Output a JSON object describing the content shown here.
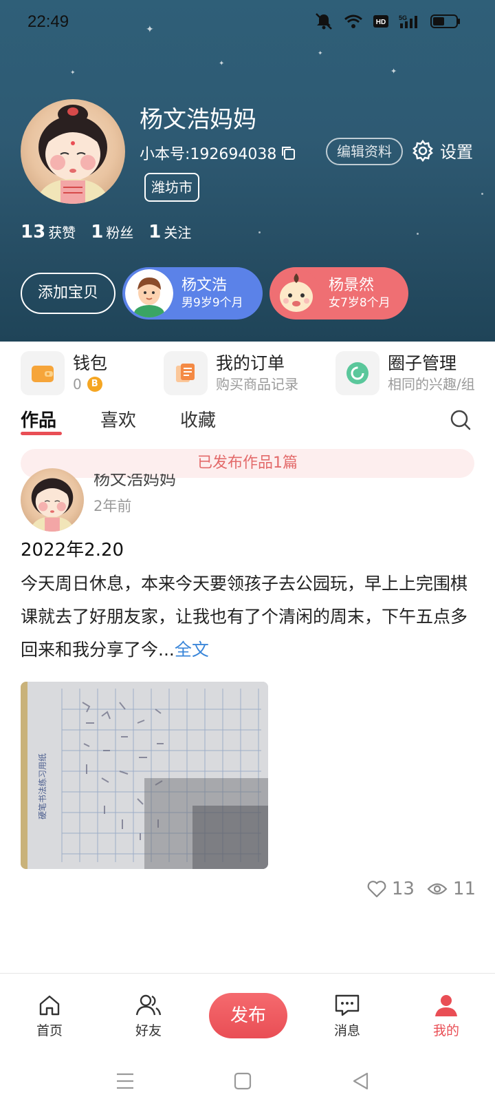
{
  "status_bar": {
    "time": "22:49"
  },
  "profile": {
    "name": "杨文浩妈妈",
    "account_id": "小本号:192694038",
    "city": "潍坊市",
    "edit_label": "编辑资料",
    "settings_label": "设置",
    "stats": [
      {
        "num": "13",
        "label": "获赞"
      },
      {
        "num": "1",
        "label": "粉丝"
      },
      {
        "num": "1",
        "label": "关注"
      }
    ]
  },
  "children": {
    "add_label": "添加宝贝",
    "items": [
      {
        "name": "杨文浩",
        "info": "男9岁9个月",
        "color": "#5b82e8"
      },
      {
        "name": "杨景然",
        "info": "女7岁8个月",
        "color": "#ef6f73"
      }
    ]
  },
  "shortcuts": [
    {
      "title": "钱包",
      "sub": "0",
      "icon": "wallet-icon"
    },
    {
      "title": "我的订单",
      "sub": "购买商品记录",
      "icon": "order-icon"
    },
    {
      "title": "圈子管理",
      "sub": "相同的兴趣/组",
      "icon": "circle-icon"
    }
  ],
  "tabs": [
    {
      "label": "作品",
      "active": true
    },
    {
      "label": "喜欢"
    },
    {
      "label": "收藏"
    }
  ],
  "published_banner": "已发布作品1篇",
  "post": {
    "author": "杨文浩妈妈",
    "time": "2年前",
    "title": "2022年2.20",
    "body": "今天周日休息，本来今天要领孩子去公园玩，早上上完围棋课就去了好朋友家，让我也有了个清闲的周末，下午五点多回来和我分享了今...",
    "read_more": "全文",
    "likes": "13",
    "views": "11"
  },
  "bottom_nav": {
    "home": "首页",
    "friends": "好友",
    "publish": "发布",
    "messages": "消息",
    "me": "我的"
  },
  "colors": {
    "accent": "#e94e55",
    "link": "#3a86d9",
    "boy": "#5b82e8",
    "girl": "#ef6f73"
  }
}
